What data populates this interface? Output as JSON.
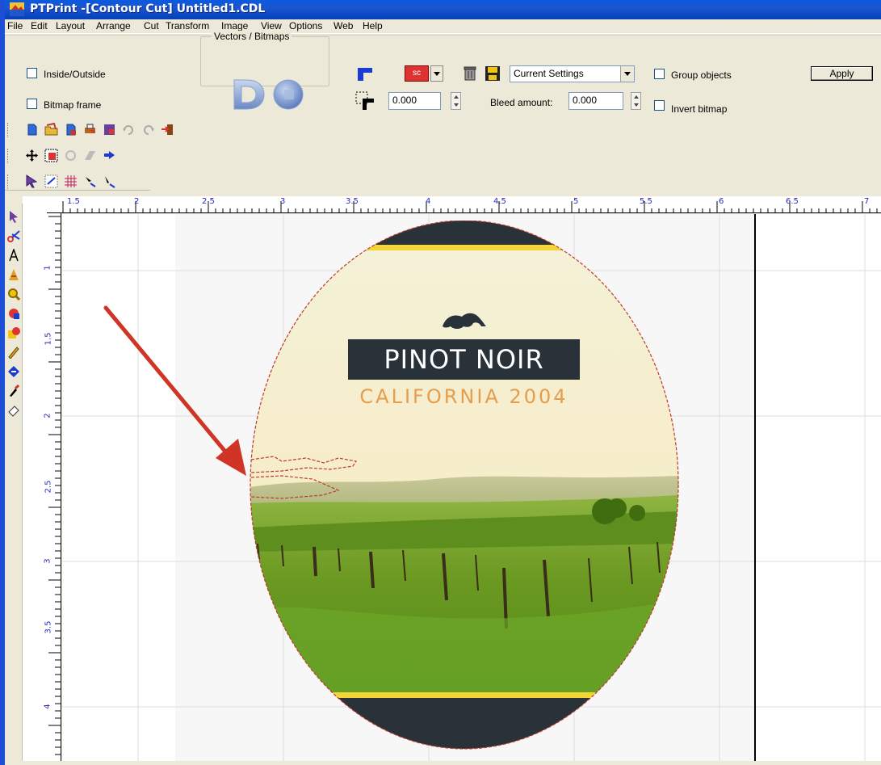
{
  "window": {
    "title": "PTPrint -[Contour Cut] Untitled1.CDL"
  },
  "menu": [
    "File",
    "Edit",
    "Layout",
    "Arrange",
    "Cut",
    "Transform",
    "Image",
    "View",
    "Options",
    "Web",
    "Help"
  ],
  "options": {
    "inside_outside": "Inside/Outside",
    "bitmap_frame": "Bitmap frame",
    "vectors_bitmaps": "Vectors / Bitmaps",
    "offset_value": "0.000",
    "sc_label": "sc",
    "preset": "Current Settings",
    "bleed_label": "Bleed amount:",
    "bleed_value": "0.000",
    "group_objects": "Group objects",
    "invert_bitmap": "Invert bitmap",
    "apply": "Apply"
  },
  "ruler": {
    "h_ticks": [
      "1.5",
      "2",
      "2.5",
      "3",
      "3.5",
      "4",
      "4.5",
      "5",
      "5.5",
      "6",
      "6.5",
      "7"
    ],
    "v_ticks": [
      "1",
      "1.5",
      "2",
      "2.5",
      "3",
      "3.5",
      "4"
    ]
  },
  "artwork": {
    "title": "PINOT NOIR",
    "subtitle": "CALIFORNIA 2004"
  },
  "colors": {
    "title_bar": "#0a5ae0",
    "contour_line": "#c0392b",
    "label_dark": "#293139",
    "label_yellow": "#f4d535",
    "subtitle_orange": "#e79d4b",
    "annotation_arrow": "#d03424"
  }
}
